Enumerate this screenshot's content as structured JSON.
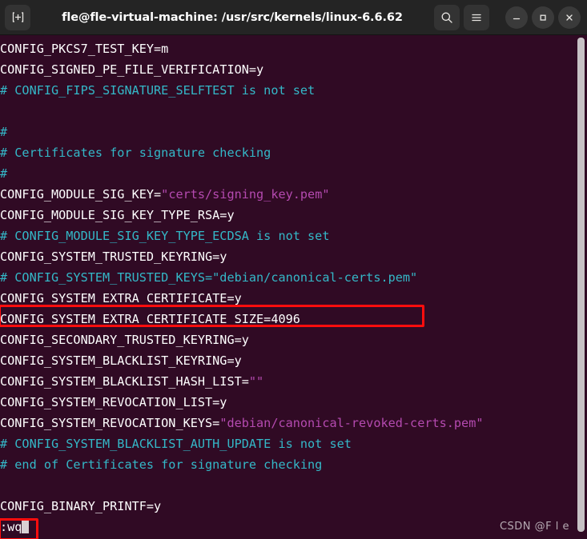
{
  "window": {
    "title": "fle@fle-virtual-machine: /usr/src/kernels/linux-6.6.62",
    "new_tab_label": "+",
    "search_icon": "search-icon",
    "menu_icon": "hamburger-menu-icon",
    "minimize_label": "–",
    "maximize_label": "□",
    "close_label": "✕",
    "titlebar_bg": "#242424",
    "terminal_bg": "#300a24"
  },
  "colors": {
    "text": "#ffffff",
    "comment": "#34b8c8",
    "string": "#b44ab0",
    "highlight_box": "#ff0d0d",
    "scrollbar": "#c7c2c5"
  },
  "terminal": {
    "lines": [
      {
        "id": "l01",
        "segments": [
          {
            "t": "CONFIG_PKCS7_TEST_KEY=m",
            "c": "white"
          }
        ]
      },
      {
        "id": "l02",
        "segments": [
          {
            "t": "CONFIG_SIGNED_PE_FILE_VERIFICATION=y",
            "c": "white"
          }
        ]
      },
      {
        "id": "l03",
        "segments": [
          {
            "t": "# CONFIG_FIPS_SIGNATURE_SELFTEST is not set",
            "c": "cyan"
          }
        ]
      },
      {
        "id": "l04",
        "segments": [
          {
            "t": "",
            "c": "white"
          }
        ]
      },
      {
        "id": "l05",
        "segments": [
          {
            "t": "#",
            "c": "cyan"
          }
        ]
      },
      {
        "id": "l06",
        "segments": [
          {
            "t": "# Certificates for signature checking",
            "c": "cyan"
          }
        ]
      },
      {
        "id": "l07",
        "segments": [
          {
            "t": "#",
            "c": "cyan"
          }
        ]
      },
      {
        "id": "l08",
        "segments": [
          {
            "t": "CONFIG_MODULE_SIG_KEY=",
            "c": "white"
          },
          {
            "t": "\"certs/signing_key.pem\"",
            "c": "mag"
          }
        ]
      },
      {
        "id": "l09",
        "segments": [
          {
            "t": "CONFIG_MODULE_SIG_KEY_TYPE_RSA=y",
            "c": "white"
          }
        ]
      },
      {
        "id": "l10",
        "segments": [
          {
            "t": "# CONFIG_MODULE_SIG_KEY_TYPE_ECDSA is not set",
            "c": "cyan"
          }
        ]
      },
      {
        "id": "l11",
        "segments": [
          {
            "t": "CONFIG_SYSTEM_TRUSTED_KEYRING=y",
            "c": "white"
          }
        ]
      },
      {
        "id": "l12",
        "segments": [
          {
            "t": "# CONFIG_SYSTEM_TRUSTED_KEYS=\"debian/canonical-certs.pem\"",
            "c": "cyan"
          }
        ]
      },
      {
        "id": "l13",
        "segments": [
          {
            "t": "CONFIG_SYSTEM_EXTRA_CERTIFICATE=y",
            "c": "white"
          }
        ]
      },
      {
        "id": "l14",
        "segments": [
          {
            "t": "CONFIG_SYSTEM_EXTRA_CERTIFICATE_SIZE=4096",
            "c": "white"
          }
        ]
      },
      {
        "id": "l15",
        "segments": [
          {
            "t": "CONFIG_SECONDARY_TRUSTED_KEYRING=y",
            "c": "white"
          }
        ]
      },
      {
        "id": "l16",
        "segments": [
          {
            "t": "CONFIG_SYSTEM_BLACKLIST_KEYRING=y",
            "c": "white"
          }
        ]
      },
      {
        "id": "l17",
        "segments": [
          {
            "t": "CONFIG_SYSTEM_BLACKLIST_HASH_LIST=",
            "c": "white"
          },
          {
            "t": "\"\"",
            "c": "mag"
          }
        ]
      },
      {
        "id": "l18",
        "segments": [
          {
            "t": "CONFIG_SYSTEM_REVOCATION_LIST=y",
            "c": "white"
          }
        ]
      },
      {
        "id": "l19",
        "segments": [
          {
            "t": "CONFIG_SYSTEM_REVOCATION_KEYS=",
            "c": "white"
          },
          {
            "t": "\"debian/canonical-revoked-certs.pem\"",
            "c": "mag"
          }
        ]
      },
      {
        "id": "l20",
        "segments": [
          {
            "t": "# CONFIG_SYSTEM_BLACKLIST_AUTH_UPDATE is not set",
            "c": "cyan"
          }
        ]
      },
      {
        "id": "l21",
        "segments": [
          {
            "t": "# end of Certificates for signature checking",
            "c": "cyan"
          }
        ]
      },
      {
        "id": "l22",
        "segments": [
          {
            "t": "",
            "c": "white"
          }
        ]
      },
      {
        "id": "l23",
        "segments": [
          {
            "t": "CONFIG_BINARY_PRINTF=y",
            "c": "white"
          }
        ]
      },
      {
        "id": "l24",
        "segments": [
          {
            "t": ":wq",
            "c": "white"
          },
          {
            "cursor": true
          }
        ]
      }
    ]
  },
  "annotations": [
    {
      "id": "redbox-trusted-keys",
      "target_line": "l12"
    },
    {
      "id": "redbox-wq",
      "target_line": "l24"
    }
  ],
  "watermark": {
    "text": "CSDN @F l e"
  }
}
